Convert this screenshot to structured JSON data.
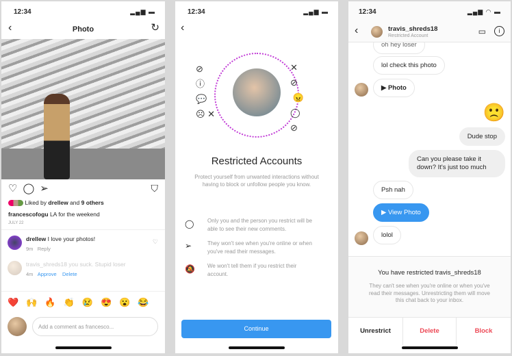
{
  "colors": {
    "accent": "#3897f0",
    "danger": "#ed4956",
    "restricted_ring": "#c13ad6"
  },
  "post": {
    "time": "12:34",
    "title": "Photo",
    "back_icon": "chevron-left",
    "refresh_icon": "refresh",
    "liked_prefix": "Liked by ",
    "liked_user": "drellew",
    "liked_mid": " and ",
    "liked_others": "9 others",
    "caption_user": "francescofogu",
    "caption_text": " LA for the weekend",
    "date": "JULY 22",
    "comments": [
      {
        "user": "drellew",
        "text": " I love your photos!",
        "time": "9m",
        "action": "Reply"
      },
      {
        "user": "travis_shreds18",
        "text": " you suck. Stupid loser",
        "time": "4m",
        "approve": "Approve",
        "delete": "Delete"
      }
    ],
    "emojis": [
      "❤️",
      "🙌",
      "🔥",
      "👏",
      "😢",
      "😍",
      "😮",
      "😂"
    ],
    "comment_placeholder": "Add a comment as francesco..."
  },
  "restrict": {
    "time": "12:34",
    "title": "Restricted Accounts",
    "description": "Protect yourself from unwanted interactions without having to block or unfollow people you know.",
    "features": [
      {
        "icon": "comment-icon",
        "text": "Only you and the person you restrict will be able to see their new comments."
      },
      {
        "icon": "send-icon",
        "text": "They won't see when you're online or when you've read their messages."
      },
      {
        "icon": "bell-off-icon",
        "text": "We won't tell them if you restrict their account."
      }
    ],
    "continue": "Continue"
  },
  "chat": {
    "time": "12:34",
    "username": "travis_shreds18",
    "subtitle": "Restricted Account",
    "messages": {
      "m0": "oh hey loser",
      "m1": "lol check this photo",
      "m2": "Photo",
      "m3": "🙁",
      "m4": "Dude stop",
      "m5": "Can you please take it down? It's just too much",
      "m6": "Psh nah",
      "m7": "View Photo",
      "m8": "lolol"
    },
    "notice_title": "You have restricted travis_shreds18",
    "notice_text": "They can't see when you're online or when you've read their messages. Unrestricting them will move this chat back to your inbox.",
    "unrestrict": "Unrestrict",
    "delete": "Delete",
    "block": "Block"
  }
}
